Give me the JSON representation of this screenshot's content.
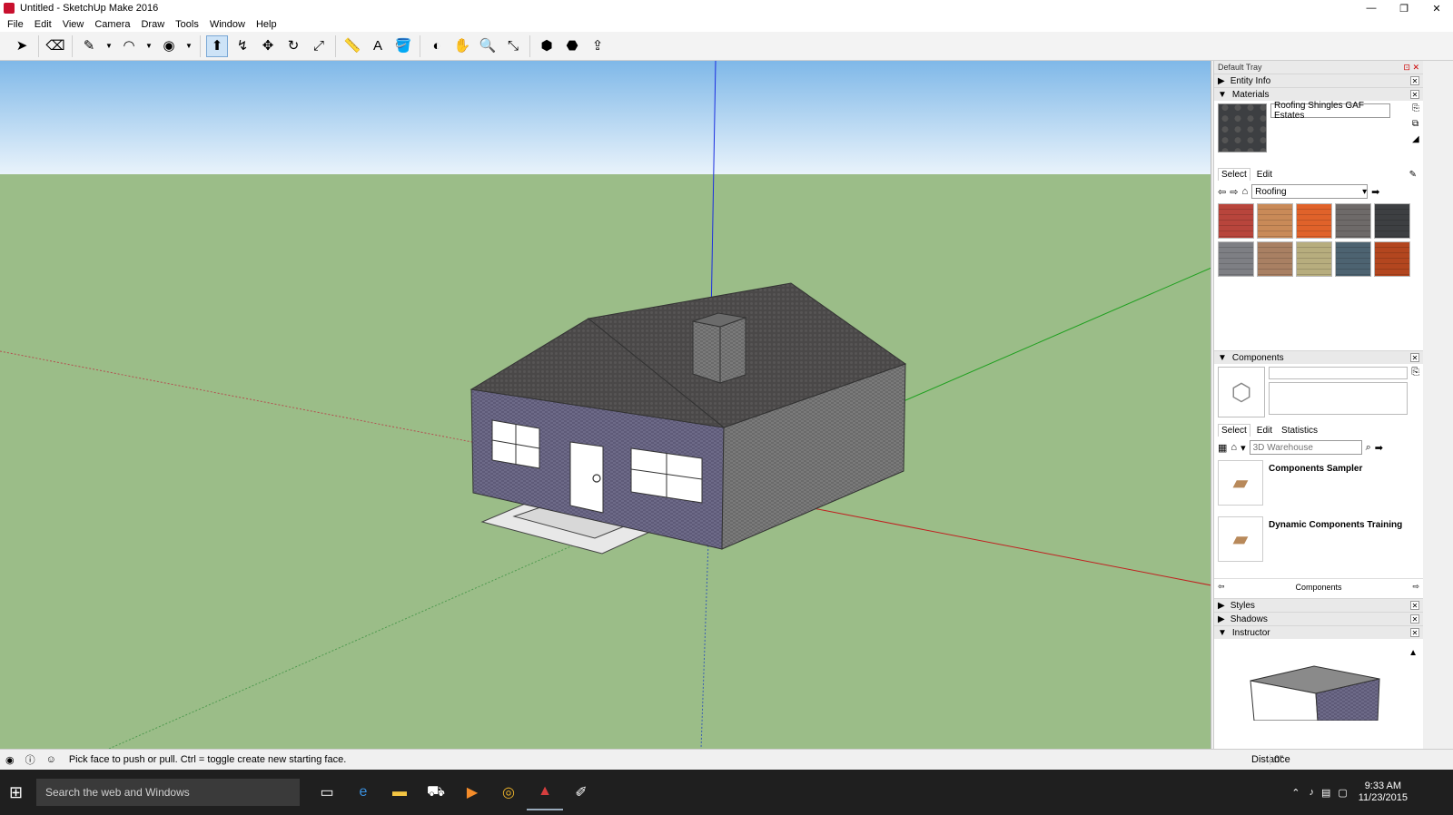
{
  "window": {
    "title": "Untitled - SketchUp Make 2016",
    "minimize": "—",
    "restore": "❐",
    "close": "✕"
  },
  "menu": [
    "File",
    "Edit",
    "View",
    "Camera",
    "Draw",
    "Tools",
    "Window",
    "Help"
  ],
  "toolbar": [
    {
      "name": "select-tool",
      "icon": "arrow",
      "glyph": "➤"
    },
    {
      "name": "eraser-tool",
      "icon": "eraser",
      "glyph": "⌫"
    },
    {
      "name": "pencil-tool",
      "icon": "pencil",
      "glyph": "✎"
    },
    {
      "name": "arc-tool",
      "icon": "arc",
      "glyph": "◠"
    },
    {
      "name": "shape-tool",
      "icon": "circle",
      "glyph": "◉"
    },
    {
      "name": "push-pull-tool",
      "icon": "push-pull",
      "glyph": "⬆"
    },
    {
      "name": "offset-tool",
      "icon": "offset",
      "glyph": "↯"
    },
    {
      "name": "move-tool",
      "icon": "move",
      "glyph": "✥"
    },
    {
      "name": "rotate-tool",
      "icon": "rotate",
      "glyph": "↻"
    },
    {
      "name": "scale-tool",
      "icon": "scale",
      "glyph": "⤢"
    },
    {
      "name": "tape-measure-tool",
      "icon": "tape",
      "glyph": "📏"
    },
    {
      "name": "text-tool",
      "icon": "text",
      "glyph": "A"
    },
    {
      "name": "paint-bucket-tool",
      "icon": "bucket",
      "glyph": "🪣"
    },
    {
      "name": "orbit-tool",
      "icon": "orbit",
      "glyph": "◐"
    },
    {
      "name": "pan-tool",
      "icon": "hand",
      "glyph": "✋"
    },
    {
      "name": "zoom-tool",
      "icon": "zoom",
      "glyph": "🔍"
    },
    {
      "name": "zoom-extents-tool",
      "icon": "zoom-extents",
      "glyph": "⤡"
    },
    {
      "name": "warehouse-tool",
      "icon": "warehouse",
      "glyph": "⬢"
    },
    {
      "name": "extension-tool",
      "icon": "extension",
      "glyph": "⬣"
    },
    {
      "name": "share-model-tool",
      "icon": "share",
      "glyph": "⇪"
    }
  ],
  "tray": {
    "title": "Default Tray",
    "entity_info": "Entity Info",
    "materials": {
      "label": "Materials",
      "current": "Roofing Shingles GAF Estates",
      "tabs": [
        "Select",
        "Edit"
      ],
      "collection": "Roofing",
      "swatch_colors": [
        "#b8453c",
        "#c98a58",
        "#e0622a",
        "#6e6a69",
        "#3d3f42",
        "#7e7f84",
        "#a98063",
        "#b7ad7e",
        "#4d6371",
        "#b3461f"
      ]
    },
    "components": {
      "label": "Components",
      "tabs": [
        "Select",
        "Edit",
        "Statistics"
      ],
      "search_placeholder": "3D Warehouse",
      "items": [
        "Components Sampler",
        "Dynamic Components Training"
      ],
      "footer": "Components"
    },
    "collapsed": [
      "Styles",
      "Shadows"
    ],
    "instructor": "Instructor"
  },
  "status": {
    "hint": "Pick face to push or pull.  Ctrl = toggle create new starting face.",
    "measure_label": "Distance",
    "measure_value": "0\""
  },
  "taskbar": {
    "search": "Search the web and Windows",
    "time": "9:33 AM",
    "date": "11/23/2015"
  }
}
